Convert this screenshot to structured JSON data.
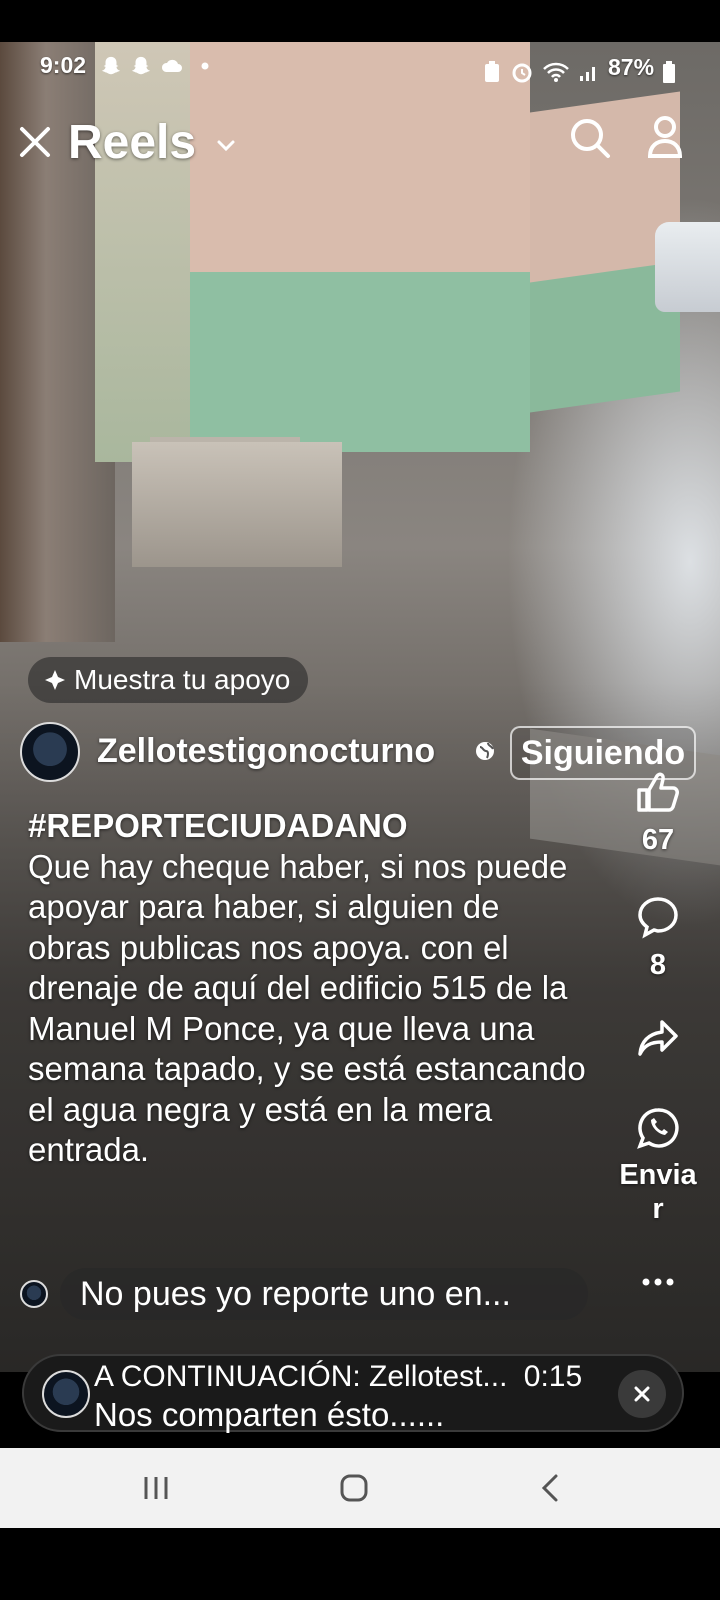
{
  "status_bar": {
    "time": "9:02",
    "battery": "87%",
    "left_icons": [
      "snapchat-icon",
      "snapchat-icon",
      "cloud-icon",
      "dot-icon"
    ],
    "right_icons": [
      "alarm-icon",
      "wifi-icon",
      "signal-icon",
      "battery-icon"
    ]
  },
  "header": {
    "title": "Reels",
    "icons": [
      "close-icon",
      "chevron-down-icon",
      "search-icon",
      "profile-icon"
    ]
  },
  "reel": {
    "support_label": "Muestra tu apoyo",
    "author": "Zellotestigonocturno",
    "follow_label": "Siguiendo",
    "hashtag": "#REPORTECIUDADANO",
    "caption": "Que hay cheque haber, si nos puede apoyar para haber, si alguien de obras publicas nos apoya. con el drenaje de aquí del edificio 515 de la Manuel M Ponce,  ya que lleva una semana tapado, y se está estancando el agua negra y está en la mera entrada.",
    "comment_preview": "No pues yo reporte uno en..."
  },
  "actions": {
    "likes": "67",
    "comments": "8",
    "send_label": "Enviar",
    "icons": [
      "like-icon",
      "comment-icon",
      "share-icon",
      "whatsapp-icon",
      "more-icon"
    ]
  },
  "up_next": {
    "label": "A CONTINUACIÓN: Zellotest...",
    "duration": "0:15",
    "title": "Nos comparten ésto......"
  },
  "colors": {
    "wall_pink": "#d9bcad",
    "wall_green": "#8fbfa2",
    "nav_bg": "#f2f2f2"
  }
}
